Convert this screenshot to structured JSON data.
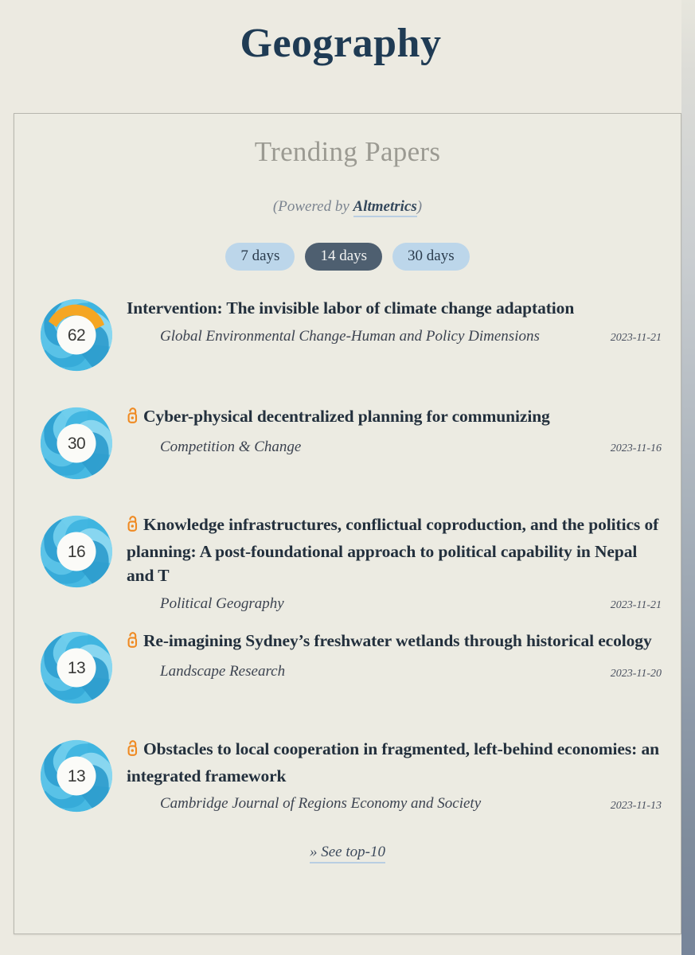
{
  "page": {
    "title": "Geography",
    "background_color": "#eceae1"
  },
  "card": {
    "heading": "Trending Papers",
    "powered_by": {
      "prefix": "(Powered by ",
      "link_label": "Altmetrics",
      "suffix": ")"
    },
    "period_filter": {
      "options": [
        {
          "label": "7 days",
          "active": false
        },
        {
          "label": "14 days",
          "active": true
        },
        {
          "label": "30 days",
          "active": false
        }
      ],
      "active_color": "#4e5f70",
      "inactive_color": "#bcd6ea"
    },
    "footer_link": "» See top-10"
  },
  "colors": {
    "title_blue": "#1f3b54",
    "heading_grey": "#9b9a92",
    "underline_blue": "#b9cee2",
    "open_access_orange": "#ef8a22",
    "badge_cyan": "#3eb4e0",
    "badge_orange": "#f5a623"
  },
  "papers": [
    {
      "score": "62",
      "open_access": false,
      "title": "Intervention: The invisible labor of climate change adaptation",
      "journal": "Global Environmental Change-Human and Policy Dimensions",
      "date": "2023-11-21",
      "badge_has_orange": true
    },
    {
      "score": "30",
      "open_access": true,
      "title": "Cyber-physical decentralized planning for communizing",
      "journal": "Competition & Change",
      "date": "2023-11-16",
      "badge_has_orange": false
    },
    {
      "score": "16",
      "open_access": true,
      "title": "Knowledge infrastructures, conflictual coproduction, and the politics of planning: A post-foundational approach to political capability in Nepal and T",
      "journal": "Political Geography",
      "date": "2023-11-21",
      "badge_has_orange": false
    },
    {
      "score": "13",
      "open_access": true,
      "title": "Re-imagining Sydney’s freshwater wetlands through historical ecology",
      "journal": "Landscape Research",
      "date": "2023-11-20",
      "badge_has_orange": false
    },
    {
      "score": "13",
      "open_access": true,
      "title": "Obstacles to local cooperation in fragmented, left-behind economies: an integrated framework",
      "journal": "Cambridge Journal of Regions Economy and Society",
      "date": "2023-11-13",
      "badge_has_orange": false
    }
  ]
}
